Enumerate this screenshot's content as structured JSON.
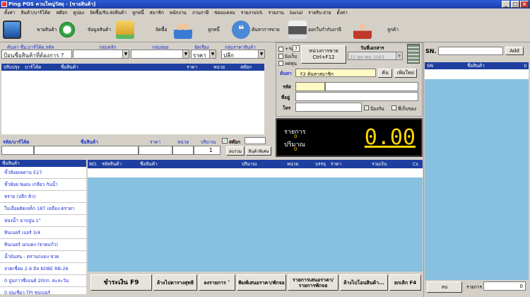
{
  "window": {
    "title": "Ping POS  ควนใหญ่วัสดุ - [ขายสินค้า]"
  },
  "menu": [
    "ตั้งค่า",
    "สินค้า/บาร์โค้ด",
    "สต๊อก",
    "คูปอง",
    "จัดซื้อ/รับ-ส่งสินค้า",
    "ลูกหนี้",
    "สมาชิก",
    "พนักงาน",
    "งานภาษี",
    "ซ่อมแคลม",
    "รายงานVS",
    "รายงาน",
    "Serial",
    "รายรับ-จ่าย",
    "ตั้งค่า"
  ],
  "toolbar": {
    "sell": "ขายสินค้า",
    "product_info": "ข้อมูลสินค้า",
    "purchase": "จัดซื้อ",
    "debtor": "ลูกหนี้",
    "search_history": "ค้นหาการขาย",
    "print_tax": "ออกใบกำกับภาษี",
    "customer": "ลูกค้า"
  },
  "search": {
    "label_name": "ค้นหา ชื่อ,บาร์โค้ด,รหัส",
    "label_main_group": "กลุ่มหลัก",
    "label_sub_group": "กลุ่มย่อย",
    "label_sort": "จัดเรียง",
    "label_price_group": "กลุ่มราคาสินค้า",
    "placeholder": "ป้อนชื่อสินค้าที่ต้องการ ?",
    "sort_value": "ราคา",
    "price_group_value": "ปลีก"
  },
  "product_table": {
    "columns": [
      "ปรับปรุง",
      "บาร์โค้ด",
      "ชื่อสินค้า",
      "ราคา",
      "หน่วย",
      "สต๊อก"
    ]
  },
  "entry": {
    "label_code": "รหัส/บาร์โค้ด",
    "label_name": "ชื่อสินค้า",
    "label_price": "ราคา",
    "label_unit": "หน่วย",
    "label_qty": "ปริมาณ",
    "qty_value": "1",
    "stock_check": "สต๊อก",
    "clear_btn": "ลบรวม",
    "special_btn": "สินค้าพิเศษ"
  },
  "options": {
    "vat": "+%",
    "vat_value": "7",
    "no_vat": "ยังเก็บ",
    "price_incl": "ลดทุน"
  },
  "cancel_btn": {
    "line1": "หน่วงการขาย",
    "line2": "Ctrl+F12"
  },
  "doc_date": {
    "label": "วันที่เอกสาร",
    "value": "22  ตุลาคม  2561"
  },
  "customer": {
    "label": "ค้นหา",
    "value": "F2 ค้นหาสมาชิก",
    "search_btn": "ค้น",
    "add_btn": "เพิ่มใหม่",
    "label_code": "รหัส",
    "label_address": "ที่อยู่",
    "label_phone": "โทร",
    "hold_check": "ป้องกัน",
    "save_check": "ที่เก็บของ"
  },
  "totals": {
    "items_label": "รายการ",
    "items_value": "0",
    "qty_label": "ปริมาณ",
    "qty_value": "0",
    "amount": "0.00"
  },
  "category_list": {
    "header": "ชื่อสินค้า",
    "items": [
      "ขั้วห้อยเพดาน E27",
      "ขั้วห้อย Nato เกลียว กันน้ำ",
      "ทราย (ปลีก คิว)",
      "ใบเลื่อยตัดเหล็ก 18T เหลือง-ตราดา",
      "ฟองน้ำ ฉาบปูน 1\"",
      "ทินเนอร์ เบอร์ 3/4",
      "ทินเนอร์ นกแดง (ขวดแก้ว)",
      "น้ำมันสน - ตรานกแดง ขวด",
      "ลวดเชื่อม 2.6 มิล KOBE RB-26",
      "0 ปูนกาวซีเมนต์ 20กก. ตะละวัน",
      "0 ปูนเชียว TPI ซุปเปอร์",
      "0 ปูนเชียว เสือซุปเปอร์"
    ]
  },
  "cart_table": {
    "columns": [
      "NO.",
      "รหัสสินค้า",
      "ชื่อสินค้า",
      "ปริมาณ",
      "หน่วย",
      "บรรจุ",
      "ราคา",
      "รวมเงิน",
      "Cs"
    ]
  },
  "actions": {
    "pay": "ชำระเงิน F9",
    "recent": "ล้างไปตารางสุทธิ",
    "list": "ลงรายการ ˄",
    "print_quote": "พิมพ์เสนอราคา/พักจอ",
    "quote_list_1": "รายการเสนอราคา/",
    "quote_list_2": "รายการพักจอ",
    "transfer": "ล้างไปโอนสินค้า...",
    "cancel": "ยกเลิก F4"
  },
  "sn": {
    "label": "SN.",
    "add_btn": "Add",
    "columns": [
      "SN",
      "ชื่อสินค้า",
      "ป"
    ],
    "delete_btn": "ลบ",
    "count_label": "รายการ",
    "count_value": "0"
  }
}
